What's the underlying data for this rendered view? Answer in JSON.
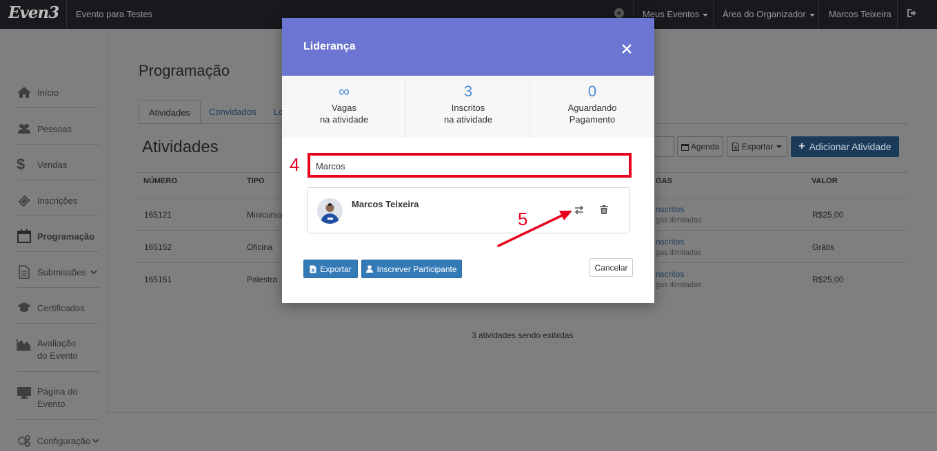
{
  "topbar": {
    "logo": "Even3",
    "event_name": "Evento para Testes",
    "nav": [
      "Meus Eventos",
      "Área do Organizador",
      "Marcos Teixeira"
    ]
  },
  "sidebar": {
    "items": [
      {
        "label": "Início",
        "icon": "home-icon"
      },
      {
        "label": "Pessoas",
        "icon": "users-icon"
      },
      {
        "label": "Vendas",
        "icon": "dollar-icon"
      },
      {
        "label": "Inscrições",
        "icon": "ticket-icon"
      },
      {
        "label": "Programação",
        "icon": "calendar-icon"
      },
      {
        "label": "Submissões",
        "icon": "document-icon"
      },
      {
        "label": "Certificados",
        "icon": "graduation-cap-icon"
      },
      {
        "label": "Avaliação do Evento",
        "line1": "Avaliação",
        "line2": "do Evento",
        "icon": "area-chart-icon"
      },
      {
        "label": "Página do Evento",
        "line1": "Página do",
        "line2": "Evento",
        "icon": "monitor-icon"
      },
      {
        "label": "Configuração",
        "icon": "gears-icon"
      }
    ]
  },
  "page": {
    "title": "Programação",
    "tabs": [
      "Atividades",
      "Convidados",
      "Lo"
    ],
    "section_title": "Atividades",
    "buttons": {
      "agenda": "Agenda",
      "exportar": "Exportar",
      "add": "Adicionar Atividade"
    },
    "table": {
      "headers": [
        "NÚMERO",
        "TIPO",
        "GAS",
        "VALOR"
      ],
      "rows": [
        {
          "numero": "165121",
          "tipo": "Minicurso",
          "vagas_link": "nscritos",
          "vagas_sub": "gas ilimitadas",
          "valor": "R$25,00"
        },
        {
          "numero": "165152",
          "tipo": "Oficina",
          "vagas_link": "nscritos",
          "vagas_sub": "gas ilimitadas",
          "valor": "Grátis"
        },
        {
          "numero": "165151",
          "tipo": "Palestra",
          "vagas_link": "nscritos",
          "vagas_sub": "gas ilimitadas",
          "valor": "R$25,00"
        }
      ],
      "footer": "3 atividades sendo exibidas"
    }
  },
  "modal": {
    "title": "Liderança",
    "stats": [
      {
        "value": "∞",
        "line1": "Vagas",
        "line2": "na atividade"
      },
      {
        "value": "3",
        "line1": "Inscritos",
        "line2": "na atividade"
      },
      {
        "value": "0",
        "line1": "Aguardando",
        "line2": "Pagamento"
      }
    ],
    "search_value": "Marcos",
    "participant": {
      "name": "Marcos Teixeira"
    },
    "buttons": {
      "export": "Exportar",
      "enroll": "Inscrever Participante",
      "cancel": "Cancelar"
    },
    "annotations": {
      "step4": "4",
      "step5": "5"
    }
  },
  "colors": {
    "modal_header": "#6c76d2",
    "accent_blue": "#337ab7",
    "annotation_red": "#e8001c",
    "stat_blue": "#4a8bd8"
  }
}
